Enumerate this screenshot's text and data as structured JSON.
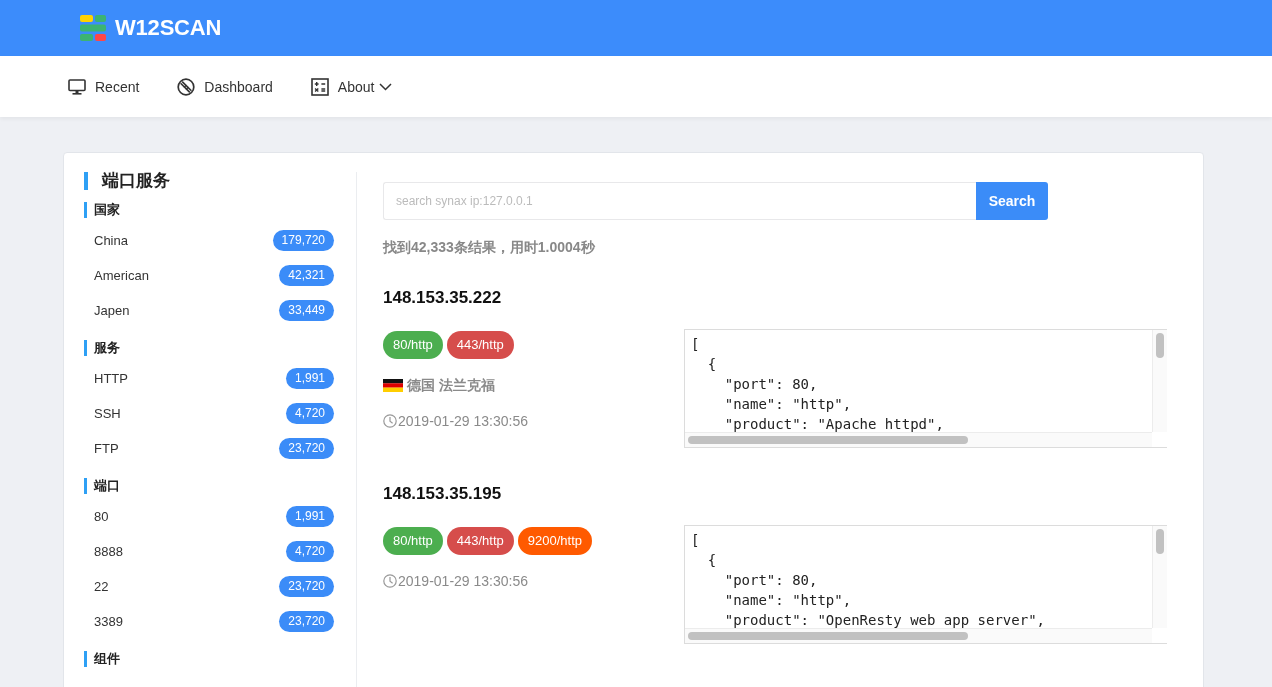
{
  "header": {
    "logo_text": "W12SCAN"
  },
  "nav": [
    {
      "label": "Recent",
      "dropdown": false
    },
    {
      "label": "Dashboard",
      "dropdown": false
    },
    {
      "label": "About",
      "dropdown": true
    }
  ],
  "sidebar": {
    "title": "端口服务",
    "sections": [
      {
        "heading": "国家",
        "items": [
          {
            "label": "China",
            "count": "179,720"
          },
          {
            "label": "American",
            "count": "42,321"
          },
          {
            "label": "Japen",
            "count": "33,449"
          }
        ]
      },
      {
        "heading": "服务",
        "items": [
          {
            "label": "HTTP",
            "count": "1,991"
          },
          {
            "label": "SSH",
            "count": "4,720"
          },
          {
            "label": "FTP",
            "count": "23,720"
          }
        ]
      },
      {
        "heading": "端口",
        "items": [
          {
            "label": "80",
            "count": "1,991"
          },
          {
            "label": "8888",
            "count": "4,720"
          },
          {
            "label": "22",
            "count": "23,720"
          },
          {
            "label": "3389",
            "count": "23,720"
          }
        ]
      },
      {
        "heading": "组件"
      }
    ]
  },
  "search": {
    "placeholder": "search synax ip:127.0.0.1",
    "button": "Search"
  },
  "summary": "找到42,333条结果，用时1.0004秒",
  "results": [
    {
      "ip": "148.153.35.222",
      "tags": [
        {
          "label": "80/http",
          "color": "#4cae4f"
        },
        {
          "label": "443/http",
          "color": "#d64d4b"
        }
      ],
      "location": "德国 法兰克福",
      "time": "2019-01-29 13:30:56",
      "code": [
        "[",
        "  {",
        "    \"port\": 80,",
        "    \"name\": \"http\",",
        "    \"product\": \"Apache httpd\","
      ]
    },
    {
      "ip": "148.153.35.195",
      "tags": [
        {
          "label": "80/http",
          "color": "#4cae4f"
        },
        {
          "label": "443/http",
          "color": "#d64d4b"
        },
        {
          "label": "9200/http",
          "color": "#ff5a00"
        }
      ],
      "time": "2019-01-29 13:30:56",
      "code": [
        "[",
        "  {",
        "    \"port\": 80,",
        "    \"name\": \"http\",",
        "    \"product\": \"OpenResty web app server\","
      ]
    }
  ]
}
